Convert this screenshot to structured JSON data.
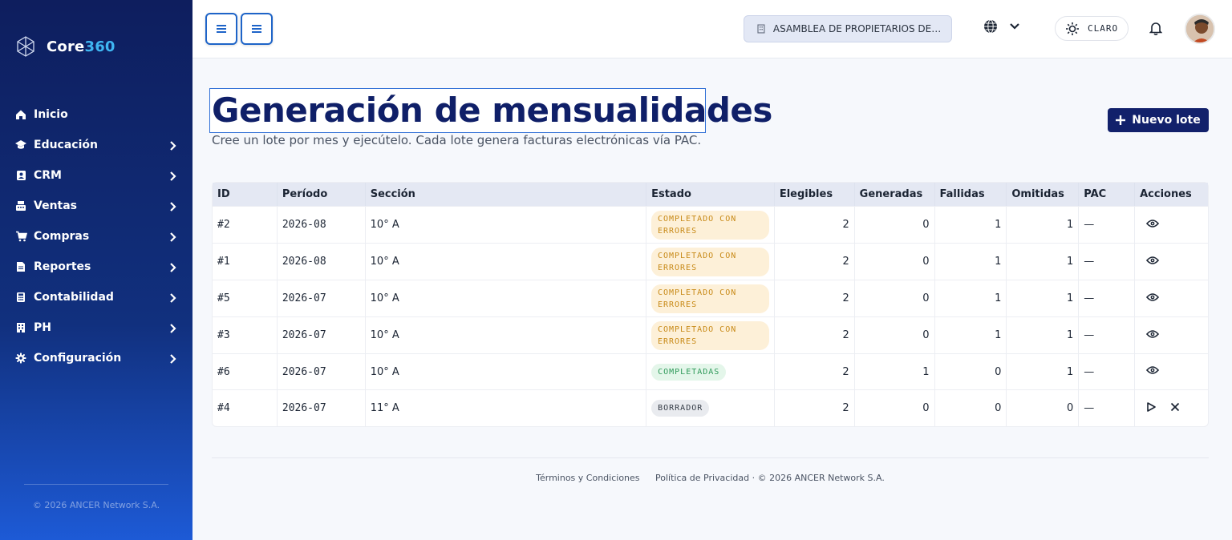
{
  "brand": {
    "name_a": "Core",
    "name_b": "360",
    "accent": "#3fb6f2"
  },
  "sidebar": {
    "items": [
      {
        "label": "Inicio",
        "icon": "home-icon",
        "has_children": false
      },
      {
        "label": "Educación",
        "icon": "graduation-cap-icon",
        "has_children": true
      },
      {
        "label": "CRM",
        "icon": "contacts-icon",
        "has_children": true
      },
      {
        "label": "Ventas",
        "icon": "cash-register-icon",
        "has_children": true
      },
      {
        "label": "Compras",
        "icon": "cart-icon",
        "has_children": true
      },
      {
        "label": "Reportes",
        "icon": "file-icon",
        "has_children": true
      },
      {
        "label": "Contabilidad",
        "icon": "calculator-icon",
        "has_children": true
      },
      {
        "label": "PH",
        "icon": "building-icon",
        "has_children": true
      },
      {
        "label": "Configuración",
        "icon": "gear-icon",
        "has_children": true
      }
    ],
    "footer": "© 2026 ANCER Network S.A."
  },
  "header": {
    "org": "ASAMBLEA DE PROPIETARIOS DE ...",
    "theme_label": "CLARO"
  },
  "page": {
    "title": "Generación de mensualidades",
    "subtitle": "Cree un lote por mes y ejecútelo. Cada lote genera facturas electrónicas vía PAC.",
    "new_button": "Nuevo lote"
  },
  "table": {
    "columns": [
      "ID",
      "Período",
      "Sección",
      "Estado",
      "Elegibles",
      "Generadas",
      "Fallidas",
      "Omitidas",
      "PAC",
      "Acciones"
    ],
    "rows": [
      {
        "id": "#2",
        "period": "2026-08",
        "section": "10° A",
        "status": "COMPLETADO CON ERRORES",
        "status_kind": "warn",
        "eligible": "2",
        "generated": "0",
        "failed": "1",
        "omitted": "1",
        "pac": "—",
        "actions": [
          "view"
        ]
      },
      {
        "id": "#1",
        "period": "2026-08",
        "section": "10° A",
        "status": "COMPLETADO CON ERRORES",
        "status_kind": "warn",
        "eligible": "2",
        "generated": "0",
        "failed": "1",
        "omitted": "1",
        "pac": "—",
        "actions": [
          "view"
        ]
      },
      {
        "id": "#5",
        "period": "2026-07",
        "section": "10° A",
        "status": "COMPLETADO CON ERRORES",
        "status_kind": "warn",
        "eligible": "2",
        "generated": "0",
        "failed": "1",
        "omitted": "1",
        "pac": "—",
        "actions": [
          "view"
        ]
      },
      {
        "id": "#3",
        "period": "2026-07",
        "section": "10° A",
        "status": "COMPLETADO CON ERRORES",
        "status_kind": "warn",
        "eligible": "2",
        "generated": "0",
        "failed": "1",
        "omitted": "1",
        "pac": "—",
        "actions": [
          "view"
        ]
      },
      {
        "id": "#6",
        "period": "2026-07",
        "section": "10° A",
        "status": "COMPLETADAS",
        "status_kind": "ok",
        "eligible": "2",
        "generated": "1",
        "failed": "0",
        "omitted": "1",
        "pac": "—",
        "actions": [
          "view"
        ]
      },
      {
        "id": "#4",
        "period": "2026-07",
        "section": "11° A",
        "status": "BORRADOR",
        "status_kind": "draft",
        "eligible": "2",
        "generated": "0",
        "failed": "0",
        "omitted": "0",
        "pac": "—",
        "actions": [
          "run",
          "delete"
        ]
      }
    ]
  },
  "footer": {
    "terms": "Términos y Condiciones",
    "privacy": "Política de Privacidad",
    "copyright": "· © 2026 ANCER Network S.A."
  },
  "colors": {
    "primary": "#12216b",
    "warn_bg": "#fdf0d8",
    "ok_bg": "#e4f6ea"
  }
}
